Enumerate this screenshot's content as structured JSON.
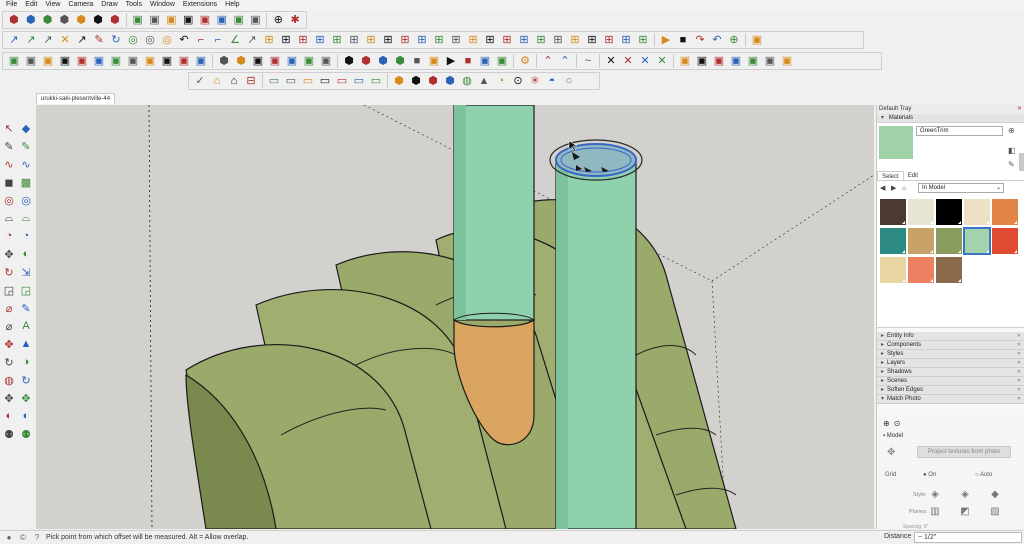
{
  "menu": [
    "File",
    "Edit",
    "View",
    "Camera",
    "Draw",
    "Tools",
    "Window",
    "Extensions",
    "Help"
  ],
  "toolbar_rows": [
    [
      "⬢",
      "⬢",
      "⬢",
      "⬢",
      "⬢",
      "⬢",
      "⬢",
      "|",
      "▣",
      "▣",
      "▣",
      "▣",
      "▣",
      "▣",
      "▣",
      "▣",
      "|",
      "⊕",
      "✱"
    ],
    [
      "↗",
      "↗",
      "↗",
      "✕",
      "↗",
      "✎",
      "↻",
      "◎",
      "◎",
      "◎",
      "↶",
      "⌐",
      "⌐",
      "∠",
      "↗",
      "⊞",
      "⊞",
      "⊞",
      "⊞",
      "⊞",
      "⊞",
      "⊞",
      "⊞",
      "⊞",
      "⊞",
      "⊞",
      "⊞",
      "⊞",
      "⊞",
      "⊞",
      "⊞",
      "⊞",
      "⊞",
      "⊞",
      "⊞",
      "⊞",
      "⊞",
      "⊞",
      "|",
      "▶",
      "■",
      "↷",
      "↶",
      "⊕",
      "|",
      "▣"
    ],
    [
      "▣",
      "▣",
      "▣",
      "▣",
      "▣",
      "▣",
      "▣",
      "▣",
      "▣",
      "▣",
      "▣",
      "▣",
      "|",
      "⬢",
      "⬢",
      "▣",
      "▣",
      "▣",
      "▣",
      "▣",
      "|",
      "⬢",
      "⬢",
      "⬢",
      "⬢",
      "■",
      "▣",
      "▶",
      "■",
      "▣",
      "▣",
      "|",
      "⚙",
      "|",
      "⌃",
      "⌃",
      "|",
      "~",
      "|",
      "✕",
      "✕",
      "✕",
      "✕",
      "|",
      "▣",
      "▣",
      "▣",
      "▣",
      "▣",
      "▣",
      "▣"
    ],
    [
      "✓",
      "⌂",
      "⌂",
      "⊟",
      "|",
      "▭",
      "▭",
      "▭",
      "▭",
      "▭",
      "▭",
      "▭",
      "|",
      "⬢",
      "⬢",
      "⬢",
      "⬢",
      "◍",
      "▲",
      "◔",
      "⊙",
      "✳",
      "◓",
      "○"
    ]
  ],
  "document_tab": "urukki-saki-plesentville-44",
  "left_tools": [
    "↖",
    "◆",
    "✎",
    "✎",
    "∿",
    "∿",
    "◼",
    "▩",
    "◎",
    "◎",
    "⌓",
    "⌓",
    "◔",
    "◔",
    "✥",
    "◐",
    "↻",
    "⇲",
    "◲",
    "◲",
    "⌀",
    "✎",
    "⌀",
    "A",
    "✥",
    "▲",
    "↻",
    "◑",
    "◍",
    "↻",
    "✥",
    "✥",
    "◐",
    "◐",
    "⚉",
    "⚉"
  ],
  "viewport": {
    "colors": {
      "background": "#d3d1ce",
      "arch": "#9aaa6a",
      "arch_dark": "#7a8a4e",
      "pipe": "#8fd1ad",
      "pipe_dark": "#6fb892",
      "wood": "#d9a560",
      "selection": "#3b66c8"
    }
  },
  "tray": {
    "title": "Default Tray",
    "materials_panel": "Materials",
    "material_name": "GreenTrim",
    "swatch_color": "#9fd3a7",
    "tabs": [
      "Select",
      "Edit"
    ],
    "library": "In Model",
    "swatches": [
      "#4a3a31",
      "#e8e4d2",
      "#000000",
      "#ece1c2",
      "#e08546",
      "#2c8a83",
      "#c7a36a",
      "#899b5d",
      "#a4d3ab",
      "#e04a32",
      "#e9d5a2",
      "#ec8060",
      "#8a6a4a"
    ],
    "selected_swatch_index": 8,
    "collapsed": [
      "Entity Info",
      "Components",
      "Styles",
      "Layers",
      "Shadows",
      "Scenes",
      "Soften Edges",
      "Match Photo"
    ],
    "match_photo": {
      "model_label": "Model",
      "project_button": "Project textures from photo",
      "grid_label": "Grid",
      "grid_on": "On",
      "grid_auto": "Auto",
      "style_label": "Style:",
      "planes_label": "Planes:",
      "spacing_label": "Spacing:",
      "spacing_value": "6\""
    }
  },
  "status": {
    "message": "Pick point from which offset will be measured. Alt = Allow overlap.",
    "measure_label": "Distance",
    "measure_value": "~ 1/2\""
  }
}
